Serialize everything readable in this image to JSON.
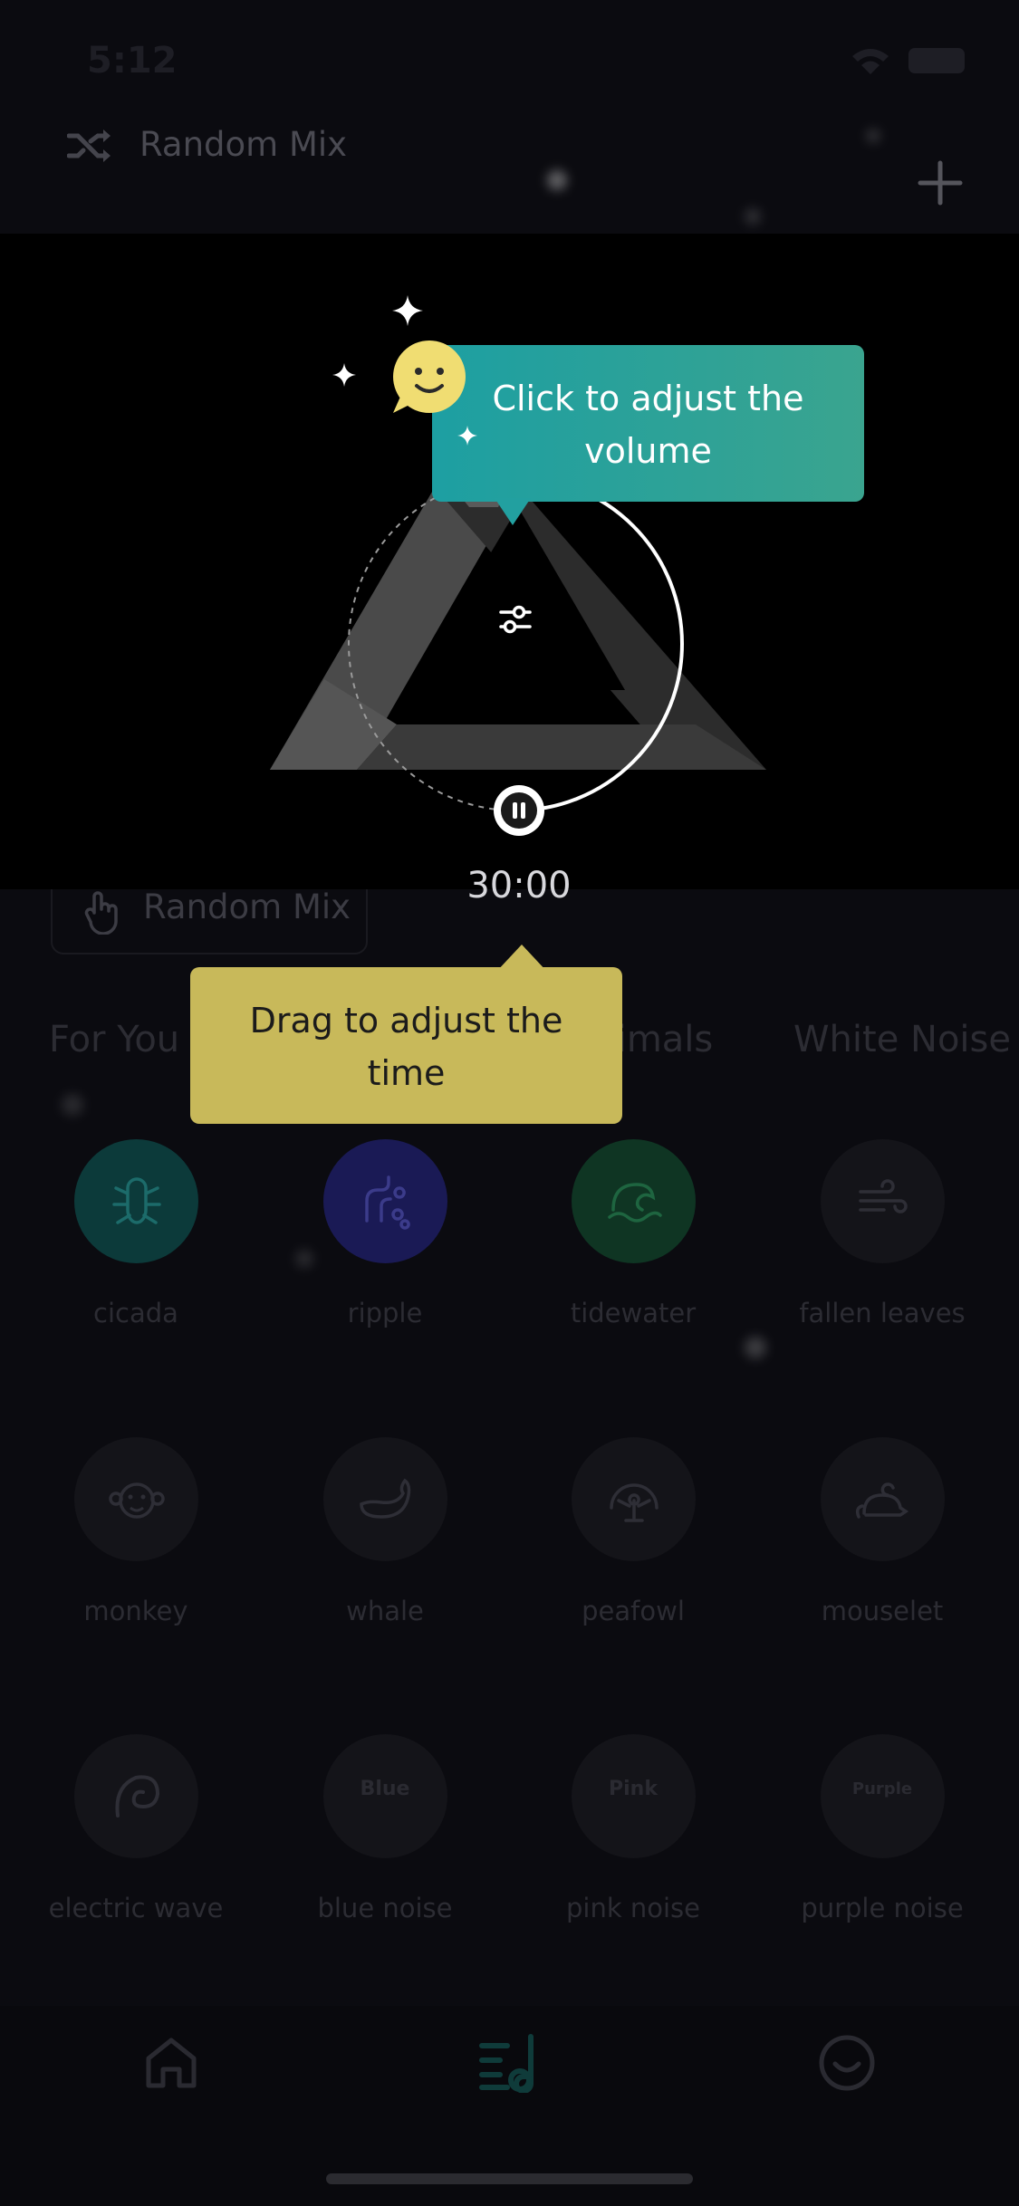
{
  "status_bar": {
    "time": "5:12"
  },
  "header": {
    "title": "Random Mix",
    "shuffle_icon": "shuffle-icon",
    "add_icon": "plus-icon"
  },
  "player": {
    "timer": "30:00",
    "control_icon": "pause-icon",
    "volume_icon": "sliders-icon"
  },
  "tooltips": {
    "volume": "Click to adjust the volume",
    "time": "Drag to adjust the time"
  },
  "mix_chip": {
    "label": "Random Mix",
    "icon": "hand-icon"
  },
  "tabs": [
    {
      "label": "For You"
    },
    {
      "label": "Animals"
    },
    {
      "label": "White Noise"
    }
  ],
  "sounds": [
    {
      "label": "cicada",
      "icon": "cicada-icon",
      "color": "#0c3a3a"
    },
    {
      "label": "ripple",
      "icon": "ripple-icon",
      "color": "#1a1a55"
    },
    {
      "label": "tidewater",
      "icon": "wave-icon",
      "color": "#0f3523"
    },
    {
      "label": "fallen leaves",
      "icon": "wind-icon",
      "color": "#141419"
    },
    {
      "label": "monkey",
      "icon": "monkey-icon",
      "color": "#141419"
    },
    {
      "label": "whale",
      "icon": "whale-icon",
      "color": "#141419"
    },
    {
      "label": "peafowl",
      "icon": "peacock-icon",
      "color": "#141419"
    },
    {
      "label": "mouselet",
      "icon": "mouse-icon",
      "color": "#141419"
    },
    {
      "label": "electric wave",
      "icon": "electric-wave-icon",
      "color": "#141419"
    },
    {
      "label": "blue noise",
      "icon_text": "Blue",
      "color": "#141419"
    },
    {
      "label": "pink noise",
      "icon_text": "Pink",
      "color": "#141419"
    },
    {
      "label": "purple noise",
      "icon_text": "Purple",
      "color": "#141419"
    }
  ],
  "bottom_nav": [
    {
      "icon": "home-icon"
    },
    {
      "icon": "playlist-icon",
      "active_color": "#0f3b3a"
    },
    {
      "icon": "profile-icon"
    }
  ]
}
